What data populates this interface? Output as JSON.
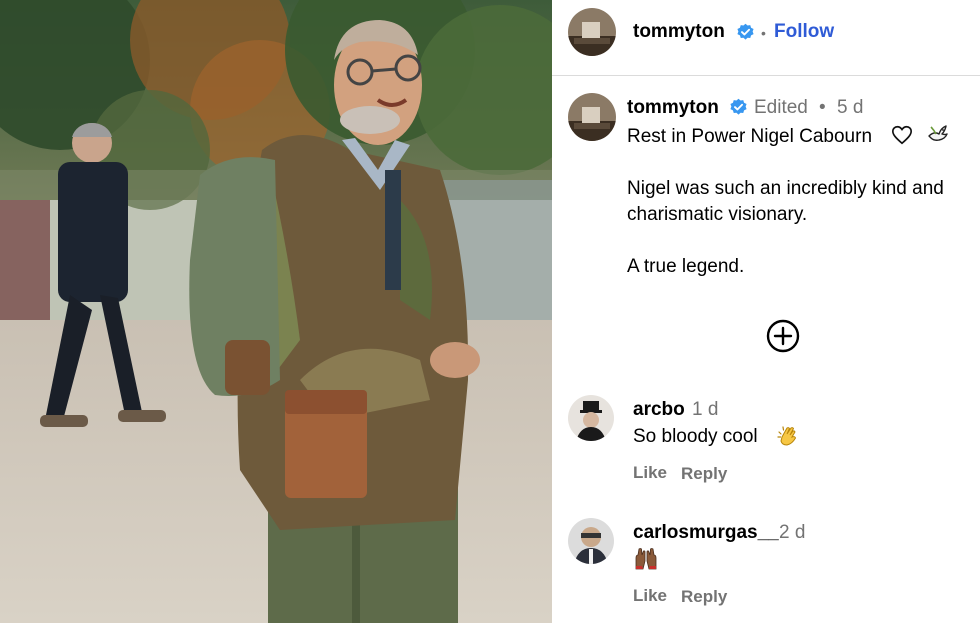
{
  "header": {
    "username": "tommyton",
    "dot": "•",
    "follow_label": "Follow"
  },
  "caption": {
    "username": "tommyton",
    "edited": "Edited",
    "dot": "•",
    "time": "5 d",
    "lines": [
      "Rest in Power Nigel Cabourn",
      "Nigel was such an incredibly kind and",
      "charismatic visionary.",
      "A true legend."
    ],
    "emojis": [
      "white-heart",
      "dove"
    ]
  },
  "comments": [
    {
      "username": "arcbo",
      "time": "1 d",
      "text": "So bloody cool",
      "emoji": "clapping-hands",
      "like_label": "Like",
      "reply_label": "Reply"
    },
    {
      "username": "carlosmurgas__",
      "time": "2 d",
      "text": "",
      "emoji": "raising-hands",
      "like_label": "Like",
      "reply_label": "Reply"
    }
  ],
  "colors": {
    "follow": "#2f5bd6",
    "verified": "#3897f0",
    "muted": "#737373",
    "divider": "#dbdbdb"
  },
  "icons": [
    "verified-badge-icon",
    "add-circle-icon",
    "heart-emoji",
    "dove-emoji",
    "clap-emoji",
    "raising-hands-emoji"
  ]
}
